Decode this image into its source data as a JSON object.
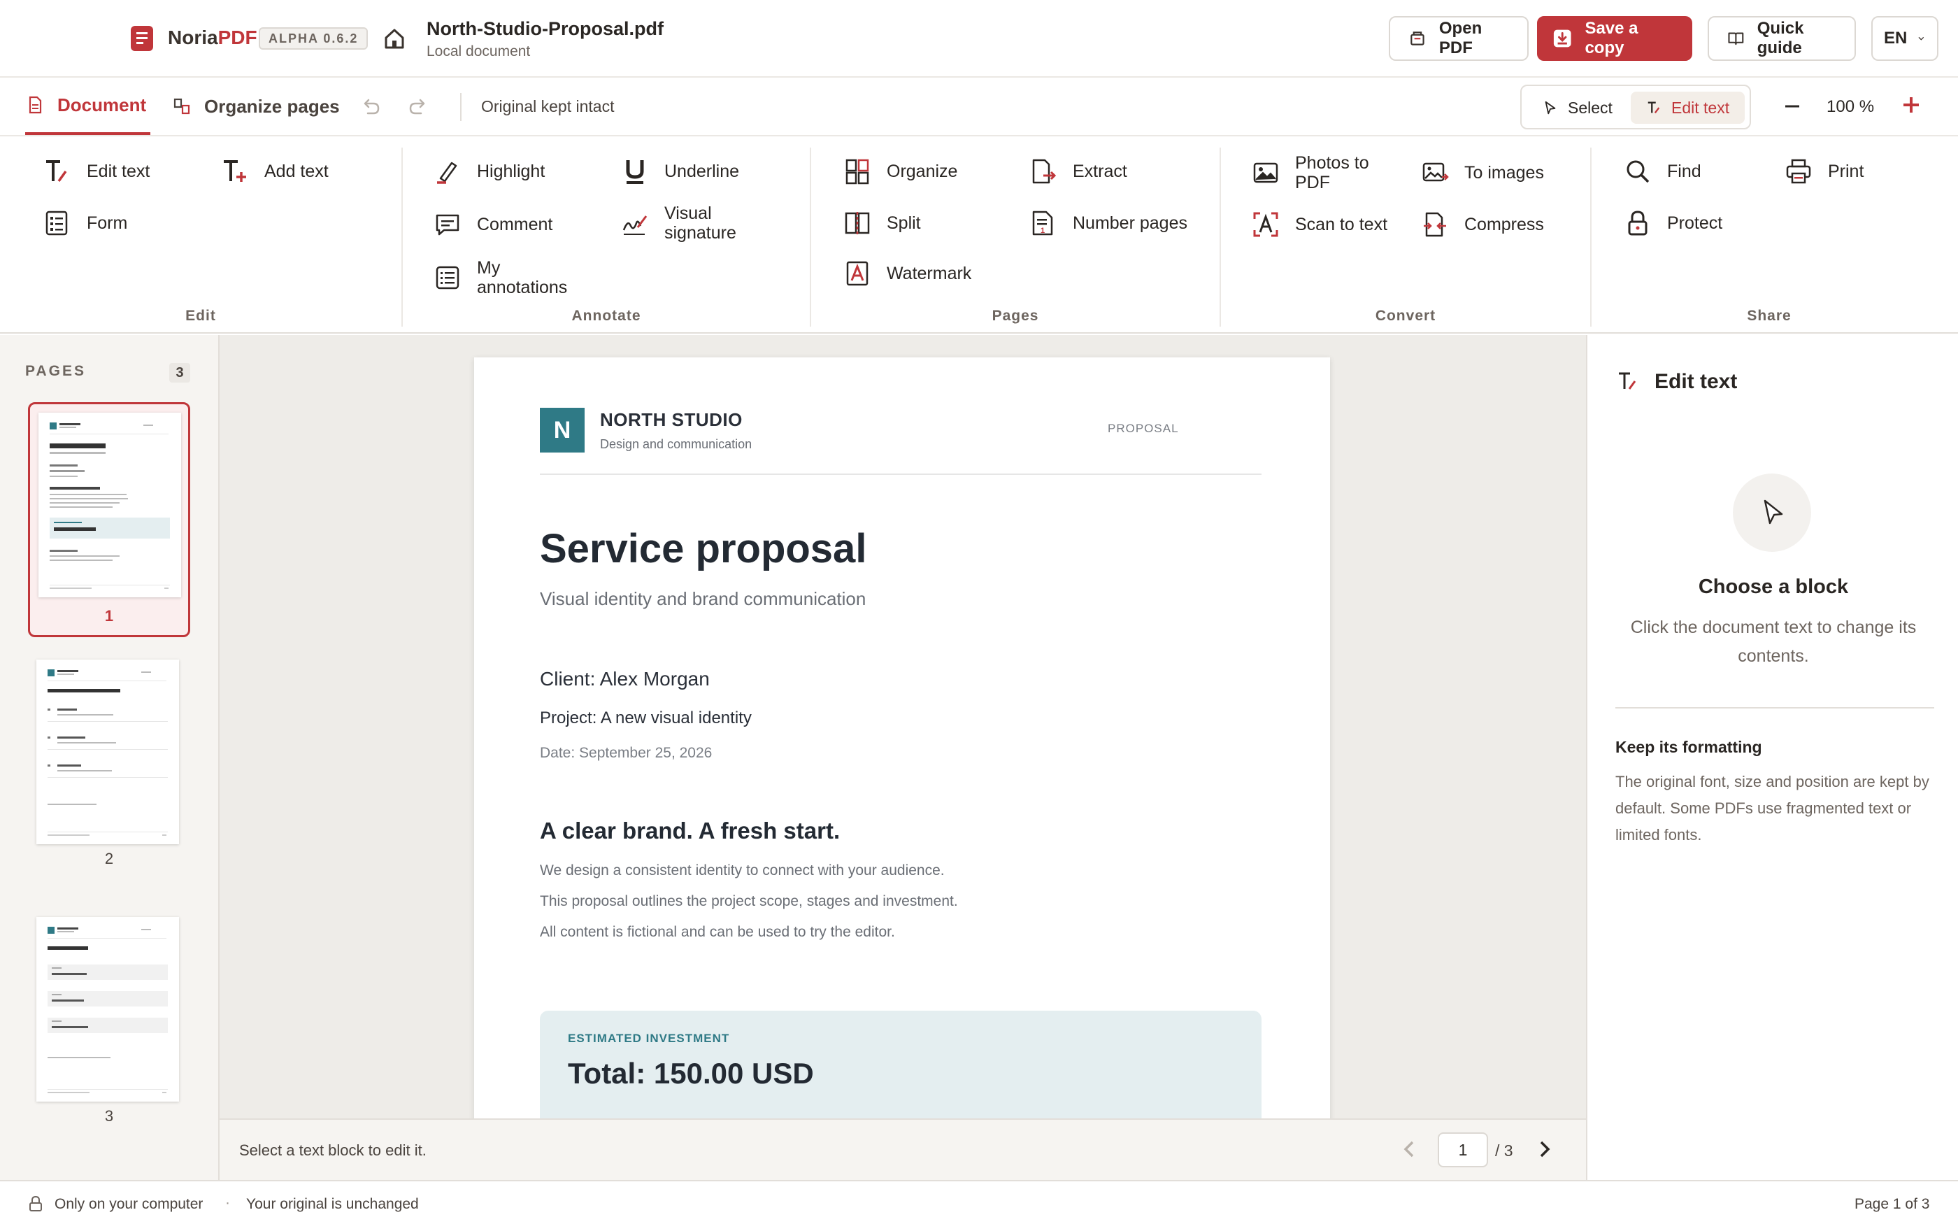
{
  "app": {
    "brand_main": "Noria",
    "brand_accent": "PDF",
    "version_badge": "ALPHA 0.6.2",
    "accent_color": "#c0363a"
  },
  "document": {
    "title": "North-Studio-Proposal.pdf",
    "subtitle": "Local document"
  },
  "header_buttons": {
    "open": "Open PDF",
    "save": "Save a copy",
    "guide": "Quick guide",
    "lang": "EN"
  },
  "tabs": [
    {
      "label": "Document",
      "active": true
    },
    {
      "label": "Organize pages",
      "active": false
    }
  ],
  "tabbar": {
    "status": "Original kept intact",
    "mode_select": "Select",
    "mode_edit": "Edit text",
    "zoom": "100 %"
  },
  "ribbon": {
    "groups": [
      {
        "label": "Edit",
        "tools": [
          "Edit text",
          "Add text",
          "Form"
        ]
      },
      {
        "label": "Annotate",
        "tools": [
          "Highlight",
          "Underline",
          "Comment",
          "Visual signature",
          "My annotations"
        ]
      },
      {
        "label": "Pages",
        "tools": [
          "Organize",
          "Extract",
          "Split",
          "Number pages",
          "Watermark"
        ]
      },
      {
        "label": "Convert",
        "tools": [
          "Photos to PDF",
          "To images",
          "Scan to text",
          "Compress"
        ]
      },
      {
        "label": "Share",
        "tools": [
          "Find",
          "Print",
          "Protect"
        ]
      }
    ],
    "line_break_labels": {
      "visual_signature": [
        "Visual",
        "signature"
      ],
      "my_annotations": [
        "My",
        "annotations"
      ],
      "photos_to_pdf": [
        "Photos to",
        "PDF"
      ]
    }
  },
  "sidebar": {
    "label": "PAGES",
    "count": "3",
    "thumbnails": [
      {
        "number": "1",
        "active": true
      },
      {
        "number": "2",
        "active": false
      },
      {
        "number": "3",
        "active": false
      }
    ]
  },
  "page": {
    "logo_letter": "N",
    "company": "NORTH STUDIO",
    "tagline": "Design and communication",
    "doc_label": "PROPOSAL",
    "heading": "Service proposal",
    "subheading": "Visual identity and brand communication",
    "client": "Client: Alex Morgan",
    "project": "Project: A new visual identity",
    "date": "Date: September 25, 2026",
    "section_title": "A clear brand. A fresh start.",
    "body_lines": [
      "We design a consistent identity to connect with your audience.",
      "This proposal outlines the project scope, stages and investment.",
      "All content is fictional and can be used to try the editor."
    ],
    "investment_label": "ESTIMATED INVESTMENT",
    "investment_total": "Total: 150.00 USD",
    "brand_color": "#2f7a86"
  },
  "canvas_footer": {
    "hint": "Select a text block to edit it.",
    "current_page": "1",
    "total_pages": "/ 3"
  },
  "right_panel": {
    "title": "Edit text",
    "choose_title": "Choose a block",
    "choose_desc": "Click the document text to change its contents.",
    "keep_title": "Keep its formatting",
    "keep_body": "The original font, size and position are kept by default. Some PDFs use fragmented text or limited fonts."
  },
  "statusbar": {
    "privacy": "Only on your computer",
    "separator": "·",
    "original": "Your original is unchanged",
    "page_info": "Page 1 of 3"
  }
}
